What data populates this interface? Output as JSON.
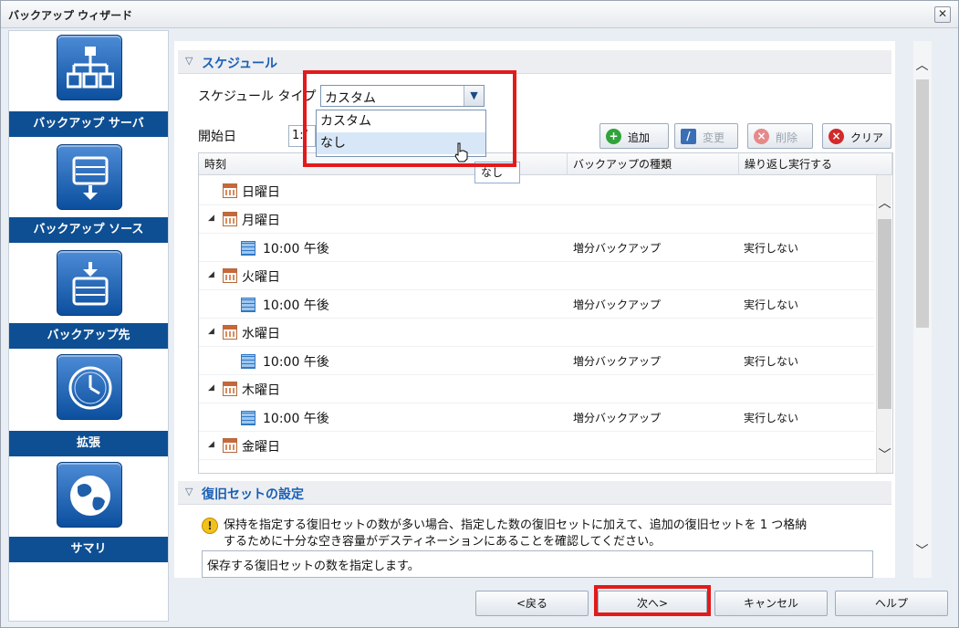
{
  "window": {
    "title": "バックアップ ウィザード",
    "close_glyph": "✕"
  },
  "sidebar": {
    "items": [
      {
        "label": "バックアップ サーバ",
        "icon": "server-tree-icon"
      },
      {
        "label": "バックアップ ソース",
        "icon": "drive-source-icon"
      },
      {
        "label": "バックアップ先",
        "icon": "drive-destination-icon"
      },
      {
        "label": "拡張",
        "icon": "clock-icon"
      },
      {
        "label": "サマリ",
        "icon": "globe-icon"
      }
    ]
  },
  "schedule": {
    "section_title": "スケジュール",
    "type_label": "スケジュール タイプ",
    "type_value": "カスタム",
    "dropdown_options": [
      "カスタム",
      "なし"
    ],
    "hovered_option": "なし",
    "start_label": "開始日",
    "start_value": "1:/",
    "tooltip": "なし",
    "toolbar": {
      "add": "追加",
      "edit": "変更",
      "delete": "削除",
      "clear": "クリア"
    },
    "columns": {
      "time": "時刻",
      "backup_type": "バックアップの種類",
      "repeat": "繰り返し実行する"
    },
    "rows": [
      {
        "kind": "day",
        "name": "日曜日",
        "expanded": false
      },
      {
        "kind": "day",
        "name": "月曜日",
        "expanded": true
      },
      {
        "kind": "time",
        "name": "10:00 午後",
        "backup_type": "増分バックアップ",
        "repeat": "実行しない"
      },
      {
        "kind": "day",
        "name": "火曜日",
        "expanded": true
      },
      {
        "kind": "time",
        "name": "10:00 午後",
        "backup_type": "増分バックアップ",
        "repeat": "実行しない"
      },
      {
        "kind": "day",
        "name": "水曜日",
        "expanded": true
      },
      {
        "kind": "time",
        "name": "10:00 午後",
        "backup_type": "増分バックアップ",
        "repeat": "実行しない"
      },
      {
        "kind": "day",
        "name": "木曜日",
        "expanded": true
      },
      {
        "kind": "time",
        "name": "10:00 午後",
        "backup_type": "増分バックアップ",
        "repeat": "実行しない"
      },
      {
        "kind": "day",
        "name": "金曜日",
        "expanded": true
      }
    ]
  },
  "recovery": {
    "section_title": "復旧セットの設定",
    "warning_line1": "保持を指定する復旧セットの数が多い場合、指定した数の復旧セットに加えて、追加の復旧セットを 1 つ格納",
    "warning_line2": "するために十分な空き容量がデスティネーションにあることを確認してください。",
    "hint": "保存する復旧セットの数を指定します。"
  },
  "footer": {
    "back": "<戻る",
    "next": "次へ>",
    "cancel": "キャンセル",
    "help": "ヘルプ"
  },
  "colors": {
    "nav_label_bg": "#0e4f93",
    "section_title": "#1a5fb4",
    "highlight": "#e21a1a"
  }
}
